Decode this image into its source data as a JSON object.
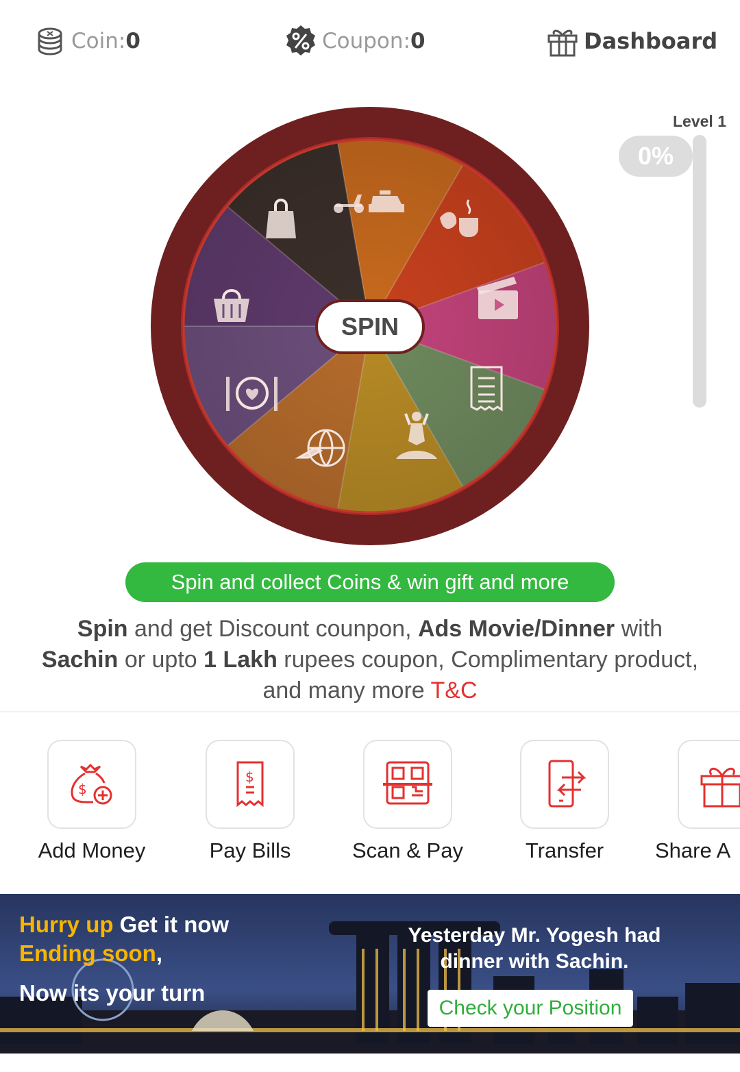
{
  "topbar": {
    "coin_label": "Coin: ",
    "coin_value": "0",
    "coupon_label": "Coupon: ",
    "coupon_value": "0",
    "dashboard_label": "Dashboard"
  },
  "wheel": {
    "spin_label": "SPIN",
    "rim_color": "#6e1f1f",
    "segments": [
      {
        "icon": "scooter-taxi-icon",
        "color": "#c86a1e"
      },
      {
        "icon": "coffee-croissant-icon",
        "color": "#c8411e"
      },
      {
        "icon": "movie-clapper-icon",
        "color": "#c2437a"
      },
      {
        "icon": "bill-receipt-icon",
        "color": "#6f8a5e"
      },
      {
        "icon": "yoga-icon",
        "color": "#b78a25"
      },
      {
        "icon": "travel-globe-icon",
        "color": "#b66c2c"
      },
      {
        "icon": "dinner-plate-icon",
        "color": "#6c4f7c"
      },
      {
        "icon": "grocery-basket-icon",
        "color": "#5f3a6c"
      },
      {
        "icon": "shopping-bag-icon",
        "color": "#3b2f2a"
      }
    ]
  },
  "level": {
    "label": "Level 1",
    "progress_text": "0%",
    "progress_fraction": 0
  },
  "banner": {
    "text": "Spin and collect Coins & win gift and more",
    "color": "#33b940"
  },
  "description": {
    "b1": "Spin",
    "t1": " and get Discount counpon, ",
    "b2": "Ads Movie/Dinner",
    "t2": " with ",
    "b3": "Sachin",
    "t3": " or upto ",
    "b4": "1 Lakh",
    "t4": " rupees coupon, Complimentary product, and many more ",
    "tc": "T&C"
  },
  "actions": [
    {
      "label": "Add Money",
      "icon": "money-bag-add-icon"
    },
    {
      "label": "Pay Bills",
      "icon": "bill-icon"
    },
    {
      "label": "Scan & Pay",
      "icon": "qr-scan-icon"
    },
    {
      "label": "Transfer",
      "icon": "phone-transfer-icon"
    },
    {
      "label": "Share A",
      "icon": "gift-icon"
    }
  ],
  "promo": {
    "hurry": "Hurry up",
    "get_it": " Get it now",
    "ending": "Ending soon",
    "comma": ",",
    "turn": "Now its your turn",
    "yesterday": "Yesterday Mr. Yogesh had dinner with Sachin.",
    "check_button": "Check your Position"
  },
  "accent_color": "#e53030"
}
